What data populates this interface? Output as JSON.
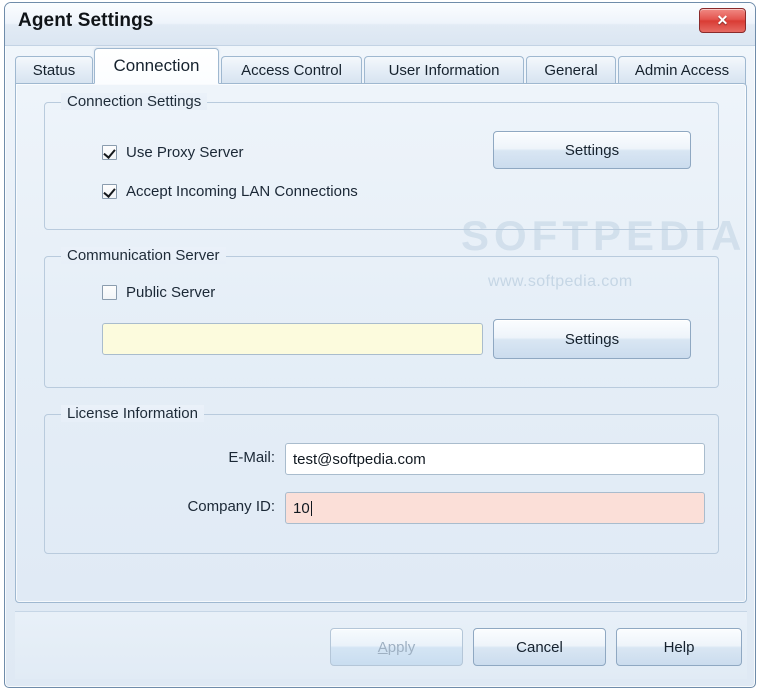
{
  "window": {
    "title": "Agent Settings",
    "close_label": "✕"
  },
  "tabs": [
    {
      "label": "Status",
      "active": false
    },
    {
      "label": "Connection",
      "active": true
    },
    {
      "label": "Access Control",
      "active": false
    },
    {
      "label": "User Information",
      "active": false
    },
    {
      "label": "General",
      "active": false
    },
    {
      "label": "Admin Access",
      "active": false
    }
  ],
  "watermark": {
    "big": "SOFTPEDIA",
    "small": "www.softpedia.com"
  },
  "connection_settings": {
    "title": "Connection Settings",
    "use_proxy": {
      "label": "Use Proxy Server",
      "checked": true
    },
    "accept_lan": {
      "label": "Accept Incoming LAN Connections",
      "checked": true
    },
    "settings_button": "Settings"
  },
  "communication_server": {
    "title": "Communication Server",
    "public_server": {
      "label": "Public Server",
      "checked": false
    },
    "server_field": {
      "value": "",
      "placeholder": ""
    },
    "settings_button": "Settings"
  },
  "license_information": {
    "title": "License Information",
    "email_label": "E-Mail:",
    "email_value": "test@softpedia.com",
    "company_label": "Company ID:",
    "company_value": "10"
  },
  "footer": {
    "apply": {
      "label": "Apply",
      "accel": "A",
      "disabled": true
    },
    "cancel": {
      "label": "Cancel",
      "disabled": false
    },
    "help": {
      "label": "Help",
      "disabled": false
    }
  },
  "colors": {
    "window_bg": "#e4edf6",
    "panel_bg": "#e5eef7",
    "accent_border": "#9fb8d0",
    "close_red": "#d93c34",
    "field_yellow": "#fcfbdd",
    "field_pink": "#fbdfd8"
  }
}
